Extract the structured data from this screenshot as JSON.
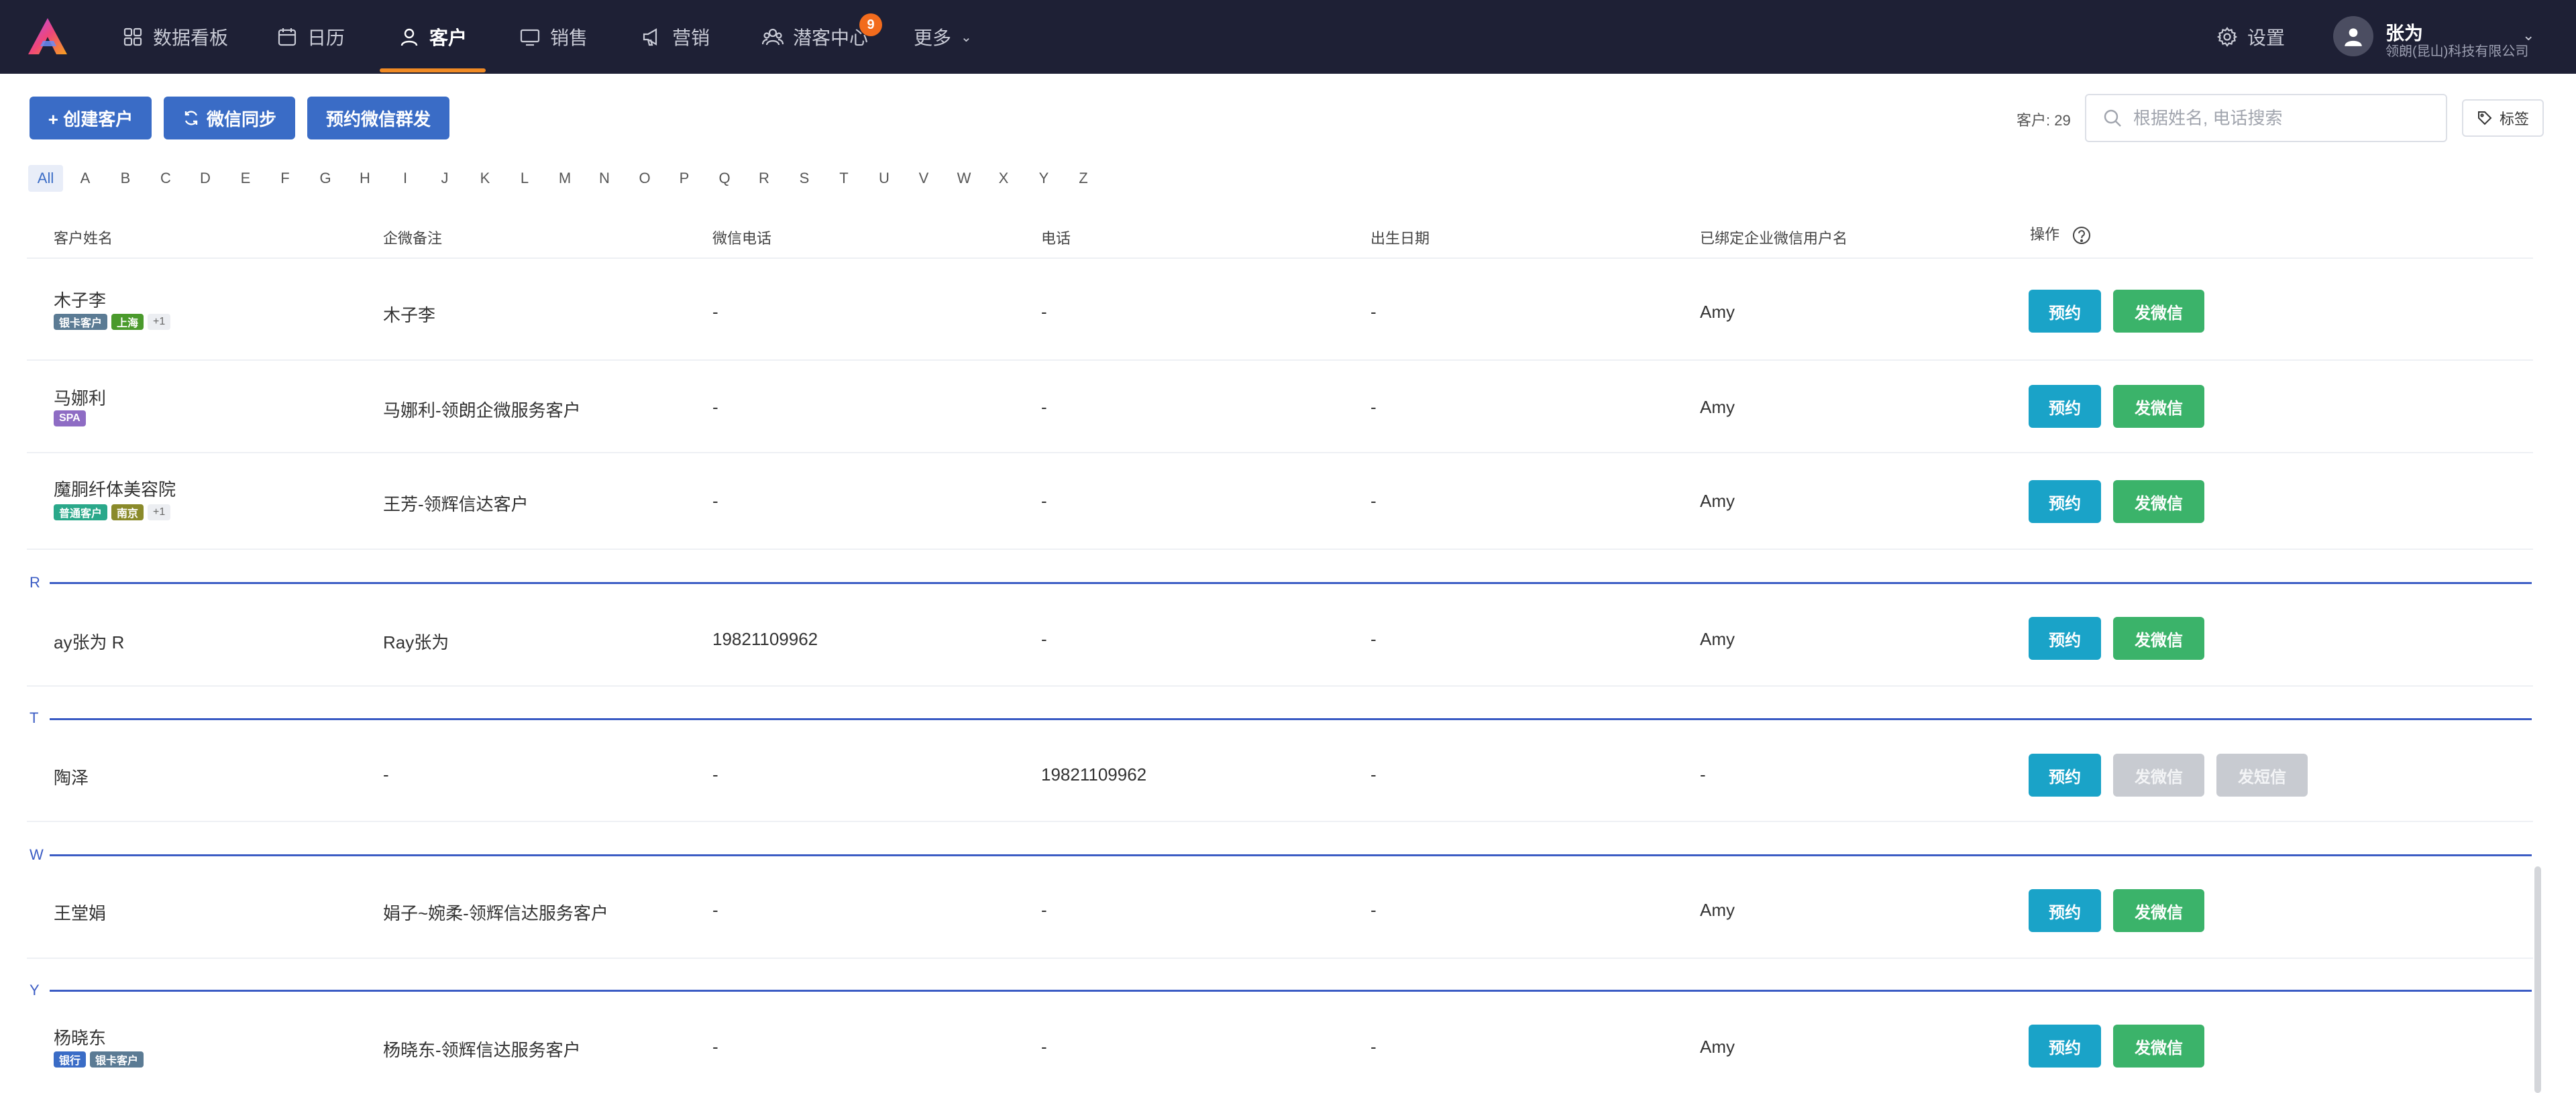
{
  "nav": {
    "items": [
      {
        "label": "数据看板",
        "icon": "dashboard-icon"
      },
      {
        "label": "日历",
        "icon": "calendar-icon"
      },
      {
        "label": "客户",
        "icon": "user-icon",
        "active": true
      },
      {
        "label": "销售",
        "icon": "monitor-icon"
      },
      {
        "label": "营销",
        "icon": "megaphone-icon"
      },
      {
        "label": "潜客中心",
        "icon": "group-icon",
        "badge": "9"
      },
      {
        "label": "更多",
        "icon": "chevron-down-icon"
      }
    ],
    "settings": "设置",
    "user": {
      "name": "张为",
      "company": "领朗(昆山)科技有限公司"
    }
  },
  "toolbar": {
    "create": "+ 创建客户",
    "sync": "微信同步",
    "broadcast": "预约微信群发",
    "count": "客户: 29",
    "search_placeholder": "根据姓名, 电话搜索",
    "tag": "标签"
  },
  "alphabet": [
    "All",
    "A",
    "B",
    "C",
    "D",
    "E",
    "F",
    "G",
    "H",
    "I",
    "J",
    "K",
    "L",
    "M",
    "N",
    "O",
    "P",
    "Q",
    "R",
    "S",
    "T",
    "U",
    "V",
    "W",
    "X",
    "Y",
    "Z"
  ],
  "table": {
    "headers": [
      "客户姓名",
      "企微备注",
      "微信电话",
      "电话",
      "出生日期",
      "已绑定企业微信用户名",
      "操作"
    ],
    "groups": [
      "R",
      "T",
      "W",
      "Y"
    ],
    "rows": [
      {
        "name": "木子李",
        "tags": [
          {
            "text": "银卡客户",
            "color": "#5b7b94"
          },
          {
            "text": "上海",
            "color": "#4a9a2c"
          }
        ],
        "more": "+1",
        "remark": "木子李",
        "wx_phone": "-",
        "phone": "-",
        "birthday": "-",
        "bound": "Amy",
        "actions": [
          "预约",
          "发微信"
        ]
      },
      {
        "name": "马娜利",
        "tags": [
          {
            "text": "SPA",
            "color": "#8e6cc4"
          }
        ],
        "more": "",
        "remark": "马娜利-领朗企微服务客户",
        "wx_phone": "-",
        "phone": "-",
        "birthday": "-",
        "bound": "Amy",
        "actions": [
          "预约",
          "发微信"
        ]
      },
      {
        "name": "魔胴纤体美容院",
        "tags": [
          {
            "text": "普通客户",
            "color": "#2aa88a"
          },
          {
            "text": "南京",
            "color": "#8a8a2a"
          }
        ],
        "more": "+1",
        "remark": "王芳-领辉信达客户",
        "wx_phone": "-",
        "phone": "-",
        "birthday": "-",
        "bound": "Amy",
        "actions": [
          "预约",
          "发微信"
        ]
      },
      {
        "name": "ay张为 R",
        "tags": [],
        "more": "",
        "remark": "Ray张为",
        "wx_phone": "19821109962",
        "phone": "-",
        "birthday": "-",
        "bound": "Amy",
        "actions": [
          "预约",
          "发微信"
        ]
      },
      {
        "name": "陶泽",
        "tags": [],
        "more": "",
        "remark": "-",
        "wx_phone": "-",
        "phone": "19821109962",
        "birthday": "-",
        "bound": "-",
        "actions": [
          "预约",
          "发微信",
          "发短信"
        ]
      },
      {
        "name": "王堂娟",
        "tags": [],
        "more": "",
        "remark": "娟子~婉柔-领辉信达服务客户",
        "wx_phone": "-",
        "phone": "-",
        "birthday": "-",
        "bound": "Amy",
        "actions": [
          "预约",
          "发微信"
        ]
      },
      {
        "name": "杨晓东",
        "tags": [
          {
            "text": "银行",
            "color": "#3a6cc6"
          },
          {
            "text": "银卡客户",
            "color": "#5b7b94"
          }
        ],
        "more": "",
        "remark": "杨晓东-领辉信达服务客户",
        "wx_phone": "-",
        "phone": "-",
        "birthday": "-",
        "bound": "Amy",
        "actions": [
          "预约",
          "发微信"
        ]
      }
    ]
  },
  "colors": {
    "nav_bg": "#1e2035",
    "accent": "#f08a24",
    "primary": "#3a6cc6",
    "book": "#1aa3c8",
    "wechat": "#3bb36a",
    "group": "#3b5cc4"
  }
}
